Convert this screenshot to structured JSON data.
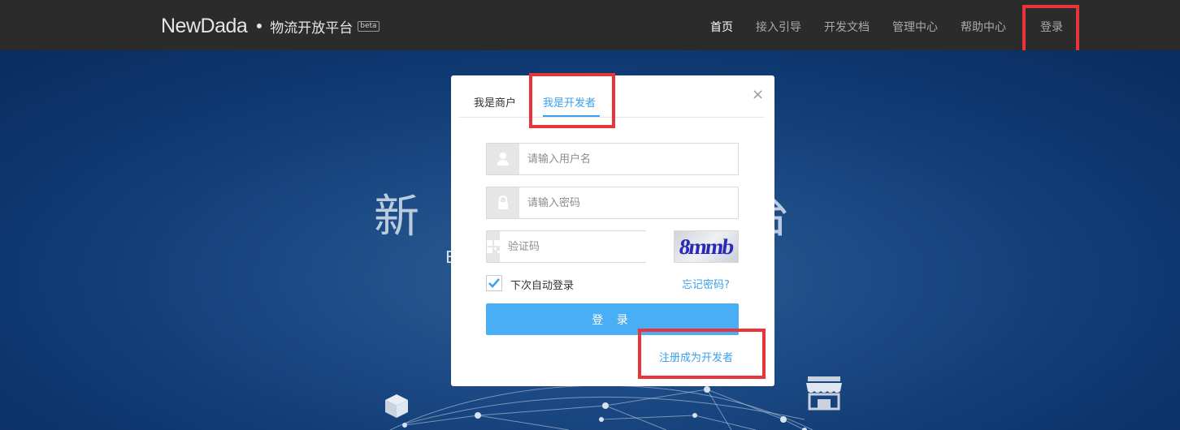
{
  "header": {
    "brand": "NewDada",
    "platform": "物流开放平台",
    "beta": "beta",
    "nav": [
      {
        "label": "首页",
        "active": true
      },
      {
        "label": "接入引导",
        "active": false
      },
      {
        "label": "开发文档",
        "active": false
      },
      {
        "label": "管理中心",
        "active": false
      },
      {
        "label": "帮助中心",
        "active": false
      },
      {
        "label": "登录",
        "active": false
      }
    ]
  },
  "hero": {
    "title_partial_left": "新",
    "title_partial_right": "台",
    "sub_partial": "B"
  },
  "modal": {
    "tabs": [
      {
        "label": "我是商户",
        "active": false
      },
      {
        "label": "我是开发者",
        "active": true
      }
    ],
    "close": "×",
    "username_placeholder": "请输入用户名",
    "password_placeholder": "请输入密码",
    "captcha_placeholder": "验证码",
    "captcha_image_text": "8mmb",
    "remember_label": "下次自动登录",
    "remember_checked": true,
    "forgot_link": "忘记密码?",
    "login_button": "登 录",
    "register_link": "注册成为开发者"
  },
  "colors": {
    "accent": "#3aa0ec",
    "button": "#4aaef5",
    "highlight": "#e8343b",
    "topbar": "#2b2b2c"
  },
  "icons": [
    "user-icon",
    "lock-icon",
    "qrcode-icon",
    "check-icon",
    "close-icon",
    "box-icon",
    "store-icon"
  ]
}
